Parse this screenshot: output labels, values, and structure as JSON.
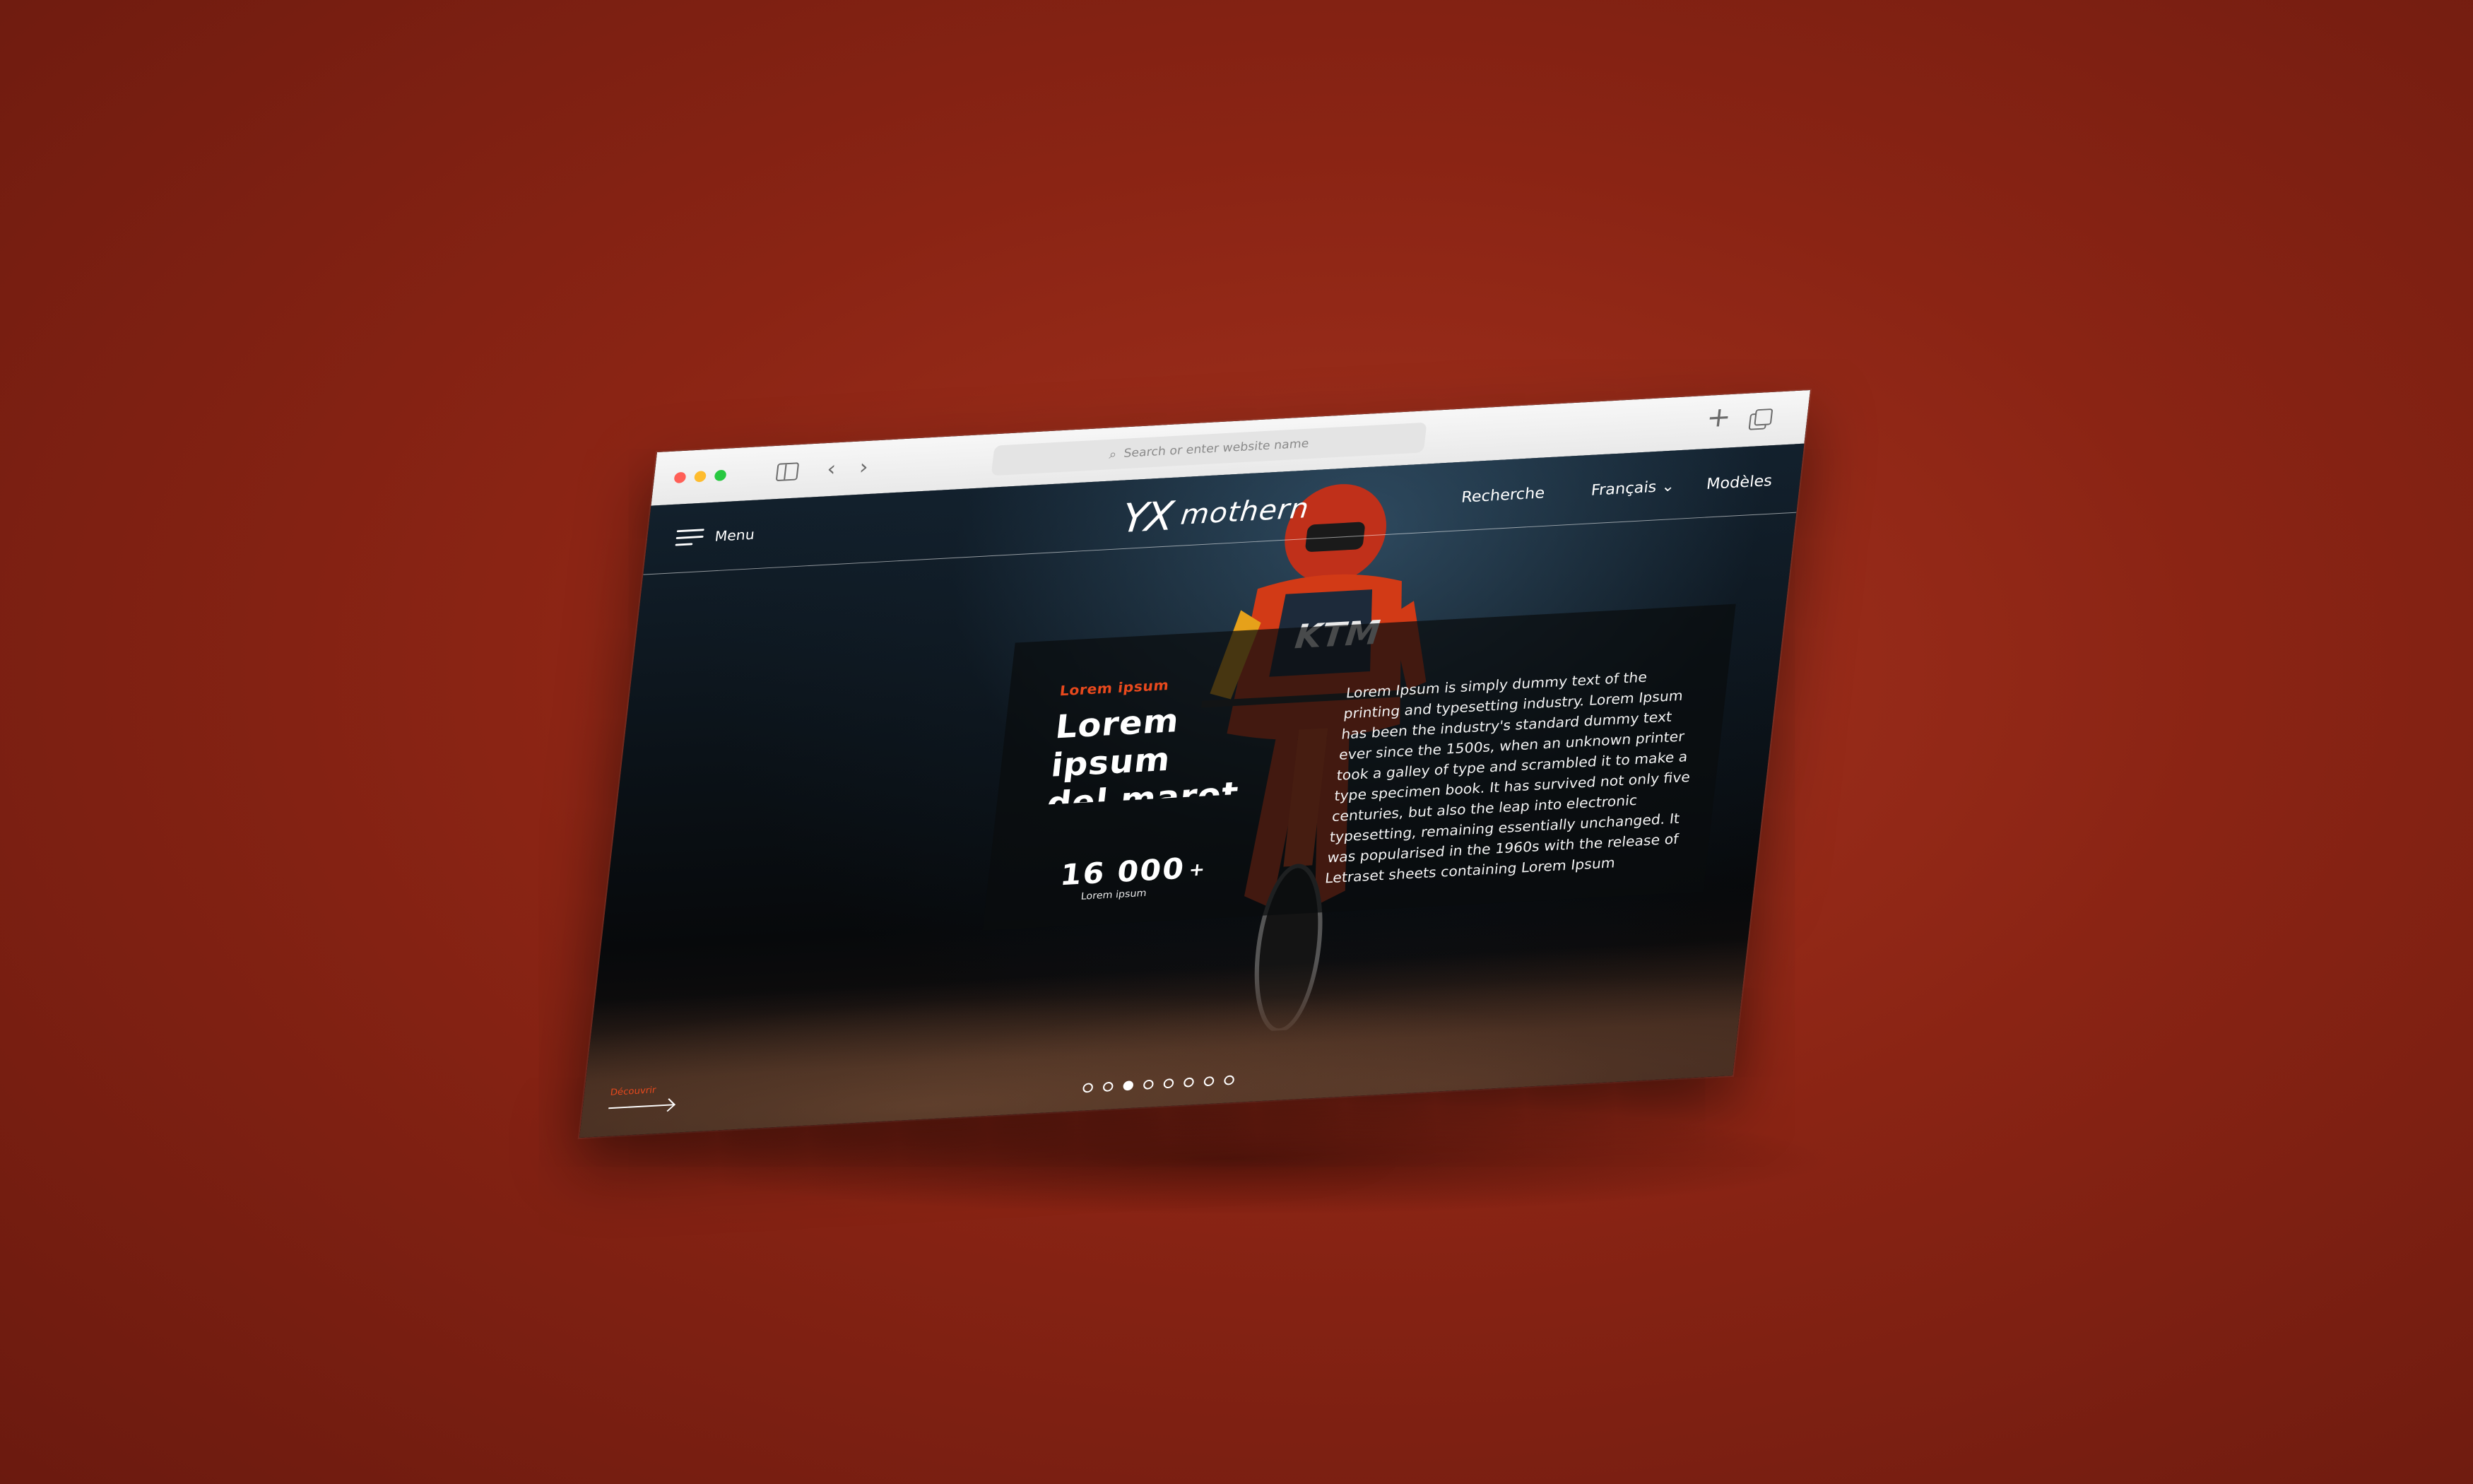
{
  "browser": {
    "address_placeholder": "Search or enter website name"
  },
  "site": {
    "menu_label": "Menu",
    "logo_text": "mothern",
    "nav": {
      "search": "Recherche",
      "language": "Français",
      "models": "Modèles"
    }
  },
  "hero": {
    "eyebrow": "Lorem ipsum",
    "headline": "Lorem ipsum\ndel marot lem",
    "stat_value": "16 000",
    "stat_suffix": "+",
    "stat_label": "Lorem ipsum",
    "body": "Lorem Ipsum is simply dummy text of the printing and typesetting industry. Lorem Ipsum has been the industry's standard dummy text ever since the 1500s, when an unknown printer took a galley of type and scrambled it to make a type specimen book. It has survived not only five centuries, but also the leap into electronic typesetting, remaining essentially unchanged. It was popularised in the 1960s with the release of Letraset sheets containing Lorem Ipsum"
  },
  "footer": {
    "discover_label": "Découvrir"
  },
  "pagination": {
    "count": 8,
    "active_index": 2
  },
  "colors": {
    "accent": "#e8491d",
    "background": "#8a2414"
  }
}
